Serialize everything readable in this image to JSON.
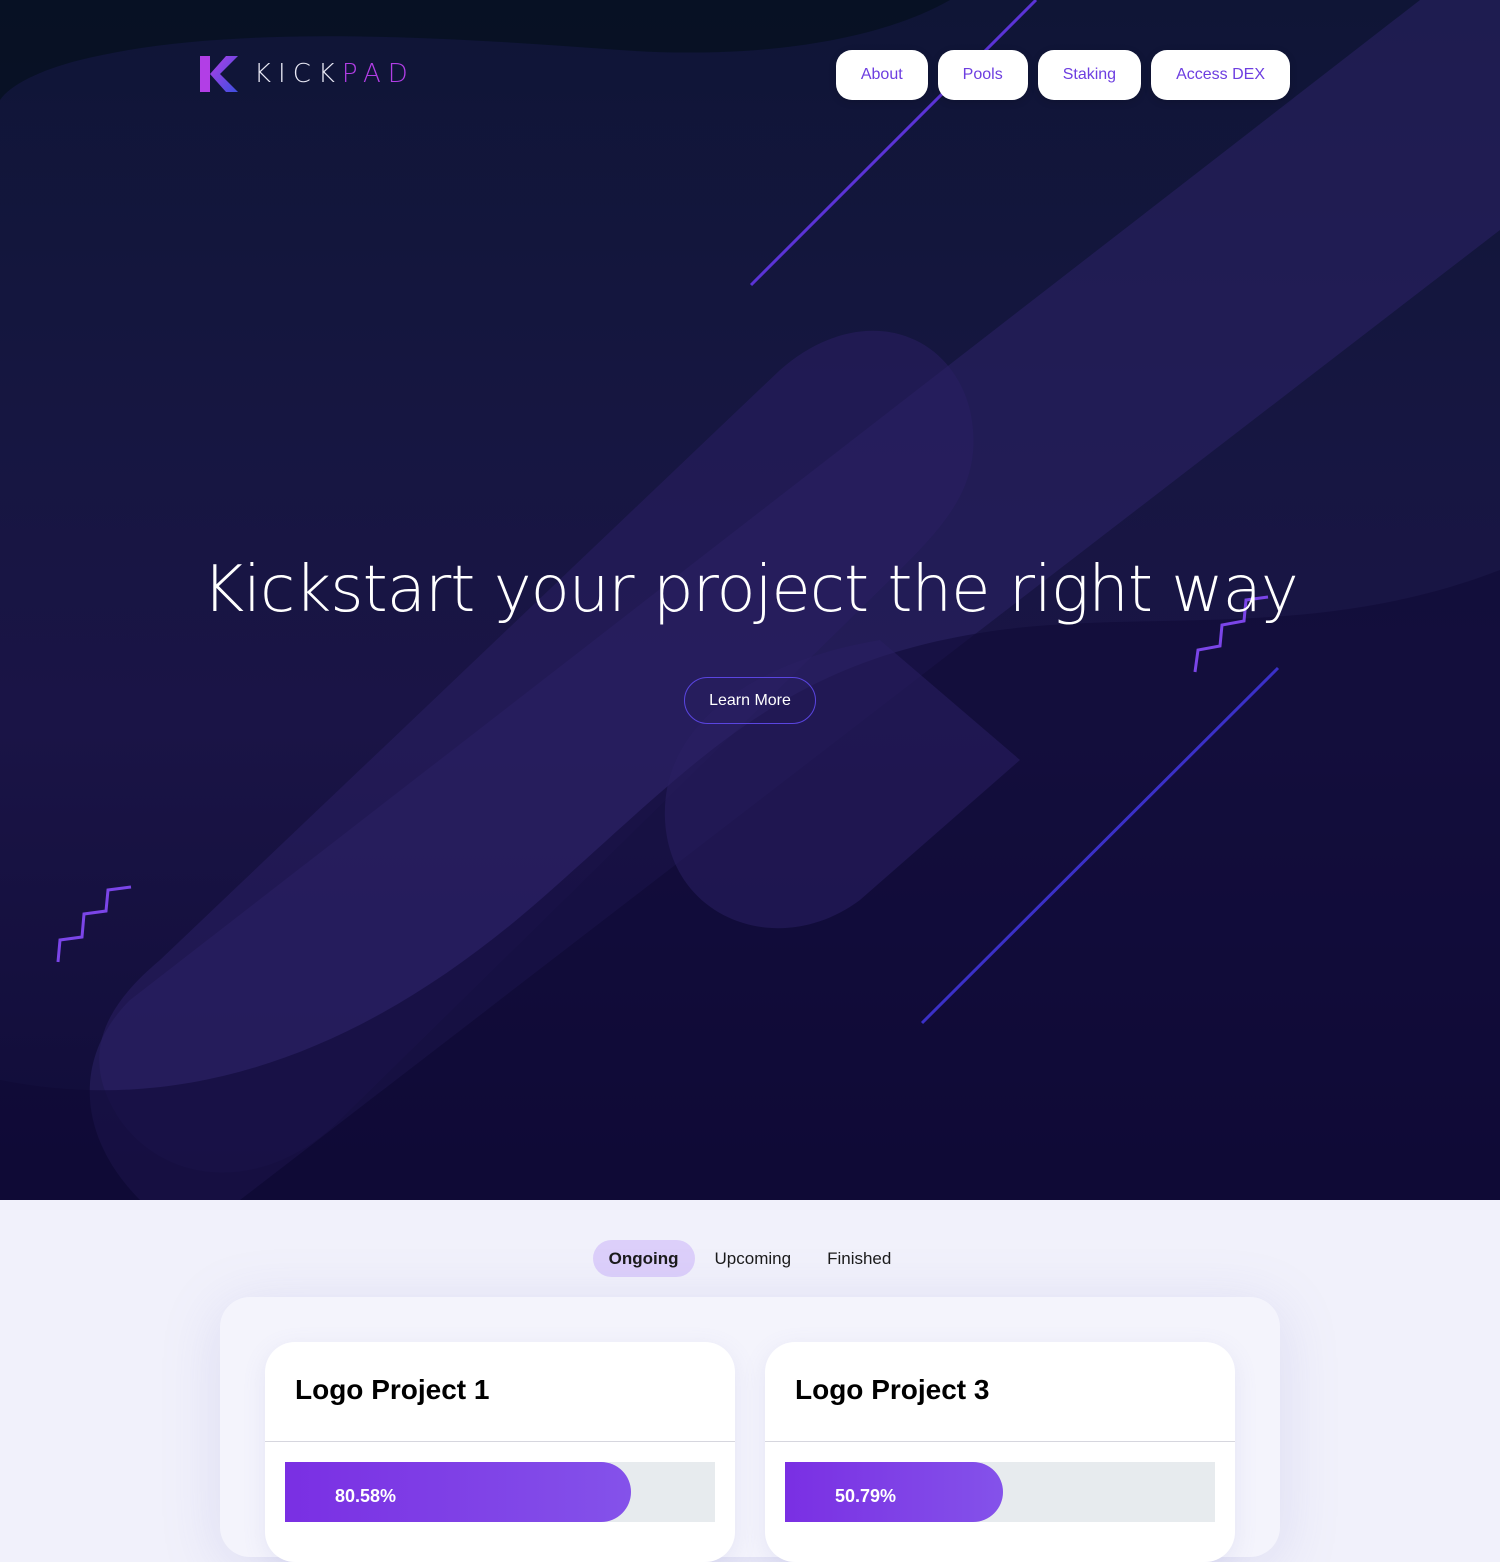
{
  "brand": {
    "name_part1": "KICK",
    "name_part2": "PAD",
    "logo_icon": "kickpad-k-logo",
    "accent_purple": "#b23ee6",
    "accent_blue": "#3d4fe0"
  },
  "nav": {
    "items": [
      {
        "label": "About"
      },
      {
        "label": "Pools"
      },
      {
        "label": "Staking"
      },
      {
        "label": "Access DEX"
      }
    ]
  },
  "hero": {
    "title": "Kickstart your project the right way",
    "cta_label": "Learn More"
  },
  "tabs": {
    "items": [
      {
        "label": "Ongoing",
        "active": true
      },
      {
        "label": "Upcoming",
        "active": false
      },
      {
        "label": "Finished",
        "active": false
      }
    ]
  },
  "projects": [
    {
      "title": "Logo Project 1",
      "progress_label": "80.58%",
      "progress": 80.58
    },
    {
      "title": "Logo Project 3",
      "progress_label": "50.79%",
      "progress": 50.79
    }
  ]
}
